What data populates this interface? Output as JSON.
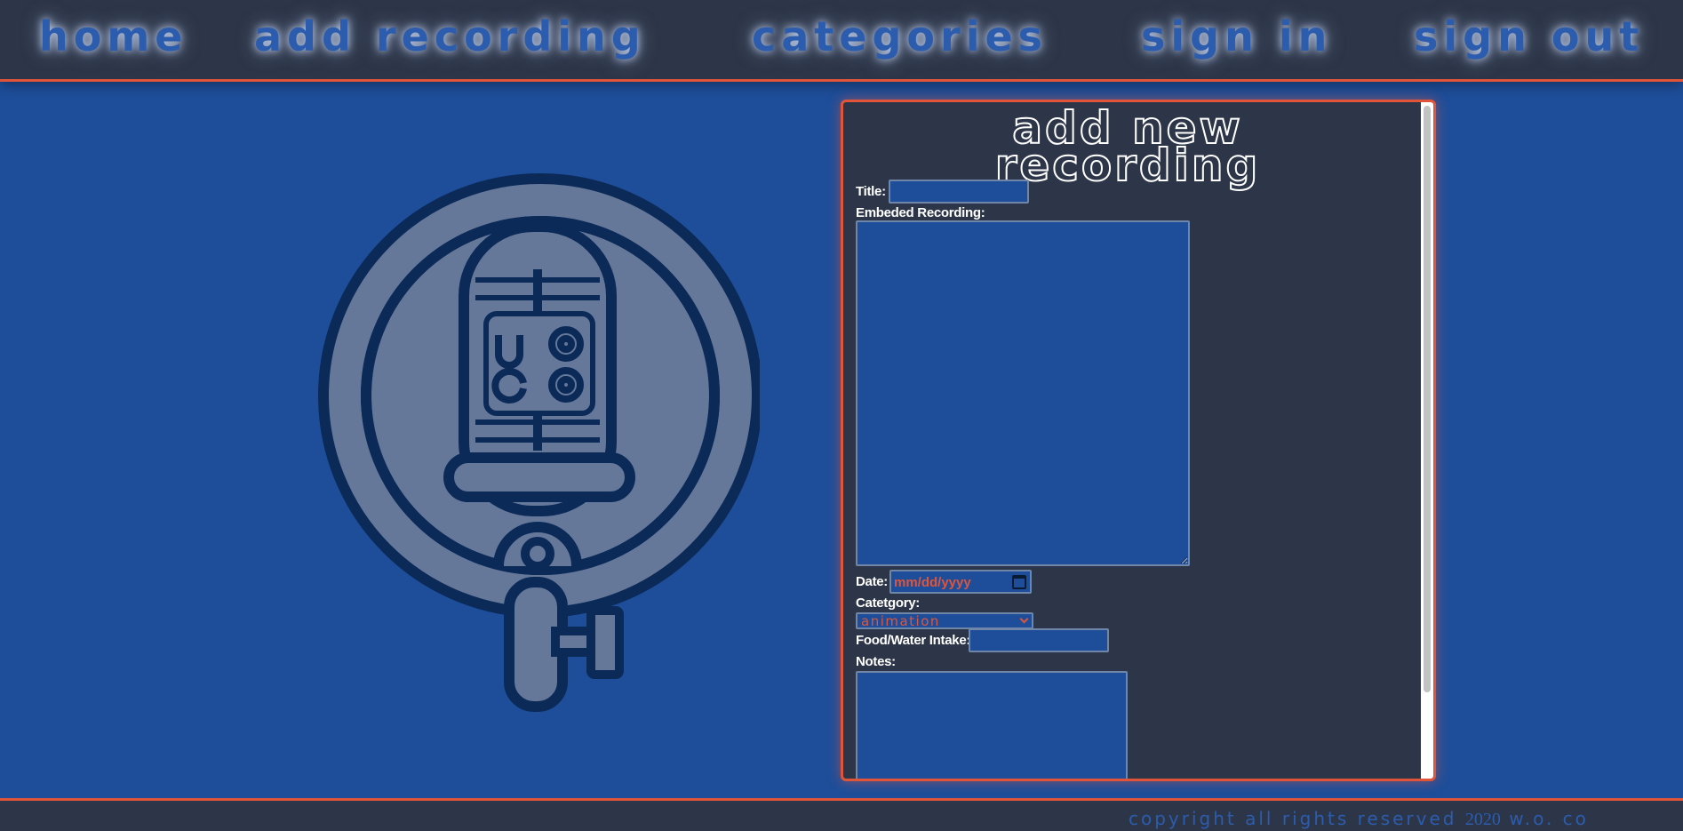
{
  "nav": {
    "items": [
      {
        "label": "Home"
      },
      {
        "label": "Add Recording"
      },
      {
        "label": "Categories"
      },
      {
        "label": "Sign In"
      },
      {
        "label": "Sign Out"
      }
    ]
  },
  "logo": {
    "icon": "microphone-logo-icon",
    "letters": [
      "W",
      "O",
      "C",
      "O"
    ]
  },
  "form": {
    "title_line1": "Add New",
    "title_line2": "Recording",
    "title_label": "Title:",
    "title_value": "",
    "embed_label": "Embeded Recording:",
    "embed_value": "",
    "date_label": "Date:",
    "date_placeholder": "mm/dd/yyyy",
    "category_label": "Catetgory:",
    "category_value": "Animation",
    "intake_label": "Food/Water Intake:",
    "intake_value": "",
    "notes_label": "Notes:",
    "notes_value": ""
  },
  "footer": {
    "copyright": "Copyright All Rights Reserved",
    "year": "2020",
    "author": "W.O. CO"
  },
  "colors": {
    "background": "#1e4e9a",
    "panel": "#2d3648",
    "accent": "#e0553a",
    "logo_dark": "#0b2a58",
    "logo_light": "#65789a"
  }
}
